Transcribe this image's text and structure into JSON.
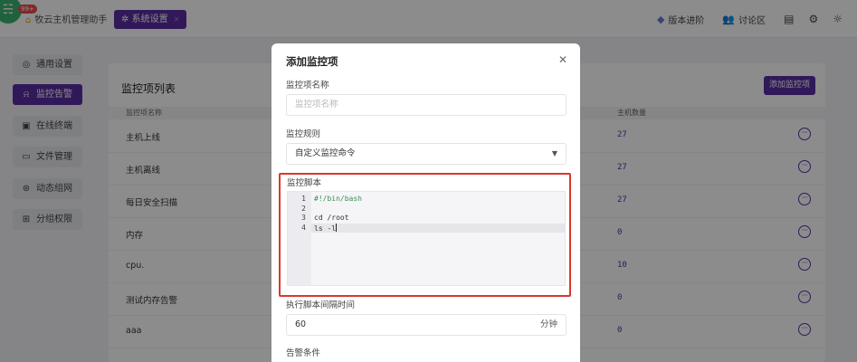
{
  "topbar": {
    "badge_count": "99+",
    "app_title": "牧云主机管理助手",
    "active_tab": "系统设置",
    "version_btn": "版本进阶",
    "forum_btn": "讨论区"
  },
  "sidebar": {
    "items": [
      {
        "label": "通用设置"
      },
      {
        "label": "监控告警"
      },
      {
        "label": "在线终端"
      },
      {
        "label": "文件管理"
      },
      {
        "label": "动态组网"
      },
      {
        "label": "分组权限"
      }
    ]
  },
  "panel": {
    "title": "监控项列表",
    "add_button": "添加监控项",
    "columns": {
      "name": "监控项名称",
      "count": "主机数量"
    },
    "rows": [
      {
        "name": "主机上线",
        "count": "27"
      },
      {
        "name": "主机离线",
        "count": "27"
      },
      {
        "name": "每日安全扫描",
        "count": "27"
      },
      {
        "name": "内存",
        "count": "0"
      },
      {
        "name": "cpu.",
        "count": "10"
      },
      {
        "name": "测试内存告警",
        "count": "0"
      },
      {
        "name": "aaa",
        "count": "0"
      }
    ]
  },
  "modal": {
    "title": "添加监控项",
    "name_label": "监控项名称",
    "name_placeholder": "监控项名称",
    "rule_label": "监控规则",
    "rule_value": "自定义监控命令",
    "script_label": "监控脚本",
    "script_lines": [
      {
        "num": "1",
        "text": "#!/bin/bash"
      },
      {
        "num": "2",
        "text": ""
      },
      {
        "num": "3",
        "text": "cd /root"
      },
      {
        "num": "4",
        "text": "ls -l"
      }
    ],
    "interval_label": "执行脚本间隔时间",
    "interval_value": "60",
    "interval_unit": "分钟",
    "alert_label": "告警条件"
  }
}
